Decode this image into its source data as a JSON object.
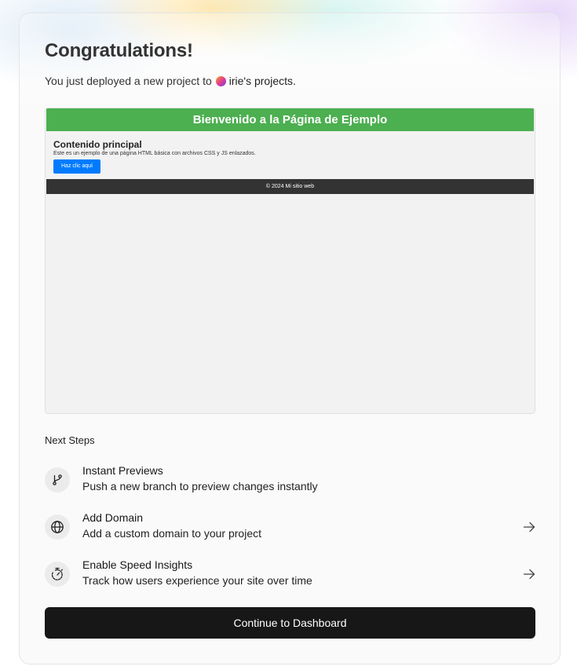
{
  "header": {
    "title": "Congratulations!",
    "subtitle_prefix": "You just deployed a new project to",
    "team_name": "irie's projects."
  },
  "preview": {
    "header_title": "Bienvenido a la Página de Ejemplo",
    "main_heading": "Contenido principal",
    "main_text": "Este es un ejemplo de una página HTML básica con archivos CSS y JS enlazados.",
    "button_label": "Haz clic aquí",
    "footer_text": "© 2024 Mi sitio web",
    "colors": {
      "header": "#4caf50",
      "button": "#007bff",
      "footer": "#333333"
    }
  },
  "next_steps": {
    "label": "Next Steps",
    "items": [
      {
        "title": "Instant Previews",
        "description": "Push a new branch to preview changes instantly",
        "icon": "git-branch-icon",
        "has_arrow": false
      },
      {
        "title": "Add Domain",
        "description": "Add a custom domain to your project",
        "icon": "globe-icon",
        "has_arrow": true
      },
      {
        "title": "Enable Speed Insights",
        "description": "Track how users experience your site over time",
        "icon": "stopwatch-icon",
        "has_arrow": true
      }
    ]
  },
  "actions": {
    "continue_label": "Continue to Dashboard"
  },
  "colors": {
    "primary_button": "#171717",
    "card_background": "#fafafa"
  }
}
